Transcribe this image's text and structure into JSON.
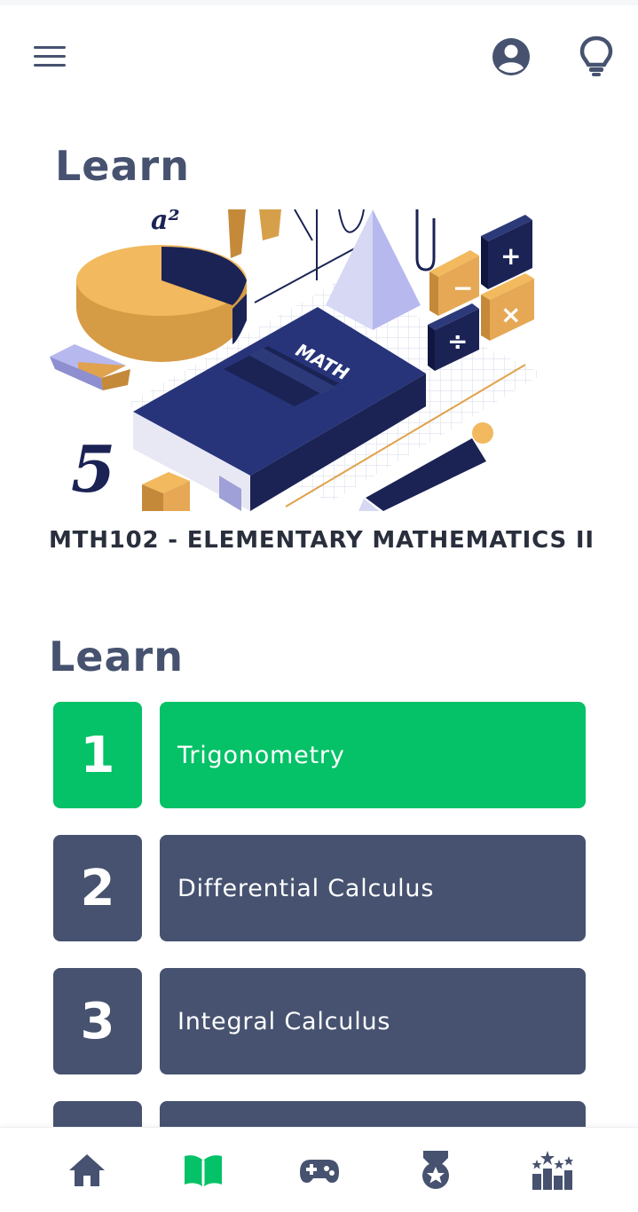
{
  "header": {
    "menu_icon": "hamburger-icon",
    "profile_icon": "user-circle-icon",
    "hint_icon": "lightbulb-icon"
  },
  "page": {
    "title": "Learn",
    "course_name": "MTH102 - ELEMENTARY MATHEMATICS II",
    "hero_text": {
      "book": "MATH",
      "digit": "5"
    }
  },
  "lessons_section": {
    "title": "Learn",
    "items": [
      {
        "number": "1",
        "label": "Trigonometry",
        "active": true
      },
      {
        "number": "2",
        "label": "Differential Calculus",
        "active": false
      },
      {
        "number": "3",
        "label": "Integral Calculus",
        "active": false
      }
    ]
  },
  "bottom_nav": {
    "items": [
      {
        "icon": "home-icon",
        "active": false
      },
      {
        "icon": "book-open-icon",
        "active": true
      },
      {
        "icon": "gamepad-icon",
        "active": false
      },
      {
        "icon": "medal-icon",
        "active": false
      },
      {
        "icon": "leaderboard-icon",
        "active": false
      }
    ],
    "colors": {
      "default": "#46526f",
      "active": "#05c167"
    }
  }
}
